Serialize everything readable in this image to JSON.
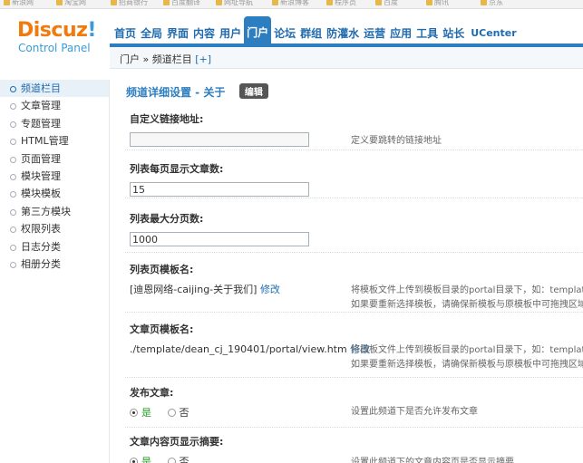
{
  "bookmarks": [
    "新浪网",
    "淘宝网",
    "招商银行",
    "百度翻译",
    "网址导航",
    "新浪博客",
    "程序员",
    "百度",
    "腾讯",
    "京东"
  ],
  "logo": {
    "main": "Discuz",
    "exclaim": "!",
    "sub": "Control Panel"
  },
  "nav": [
    {
      "label": "首页"
    },
    {
      "label": "全局"
    },
    {
      "label": "界面"
    },
    {
      "label": "内容"
    },
    {
      "label": "用户"
    },
    {
      "label": "门户",
      "active": true
    },
    {
      "label": "论坛"
    },
    {
      "label": "群组"
    },
    {
      "label": "防灌水"
    },
    {
      "label": "运营"
    },
    {
      "label": "应用"
    },
    {
      "label": "工具"
    },
    {
      "label": "站长"
    },
    {
      "label": "UCenter"
    }
  ],
  "breadcrumb": {
    "root": "门户",
    "sep": "»",
    "current": "频道栏目",
    "plus": "[+]"
  },
  "sidebar": [
    {
      "label": "频道栏目",
      "active": true
    },
    {
      "label": "文章管理"
    },
    {
      "label": "专题管理"
    },
    {
      "label": "HTML管理"
    },
    {
      "label": "页面管理"
    },
    {
      "label": "模块管理"
    },
    {
      "label": "模块模板"
    },
    {
      "label": "第三方模块"
    },
    {
      "label": "权限列表"
    },
    {
      "label": "日志分类"
    },
    {
      "label": "相册分类"
    }
  ],
  "main": {
    "title": "频道详细设置 - 关于",
    "edit_label": "编辑",
    "fields": {
      "link": {
        "label": "自定义链接地址:",
        "value": "",
        "hint": "定义要跳转的链接地址"
      },
      "per_page": {
        "label": "列表每页显示文章数:",
        "value": "15"
      },
      "max_pages": {
        "label": "列表最大分页数:",
        "value": "1000"
      },
      "list_tpl": {
        "label": "列表页模板名:",
        "value": "[迪恩网络-caijing-关于我们]",
        "action": "修改",
        "hint1": "将模板文件上传到模板目录的portal目录下，如：template/d",
        "hint2": "如果要重新选择模板，请确保新模板与原模板中可拖拽区域具有"
      },
      "article_tpl": {
        "label": "文章页模板名:",
        "value": "./template/dean_cj_190401/portal/view.htm",
        "action": "修改",
        "hint1": "将模板文件上传到模板目录的portal目录下，如：template/d",
        "hint2": "如果要重新选择模板，请确保新模板与原模板中可拖拽区域具有"
      },
      "publish": {
        "label": "发布文章:",
        "yes": "是",
        "no": "否",
        "hint": "设置此频道下是否允许发布文章"
      },
      "summary": {
        "label": "文章内容页显示摘要:",
        "yes": "是",
        "no": "否",
        "hint": "设置此频道下的文章内容页是否显示摘要"
      }
    }
  }
}
